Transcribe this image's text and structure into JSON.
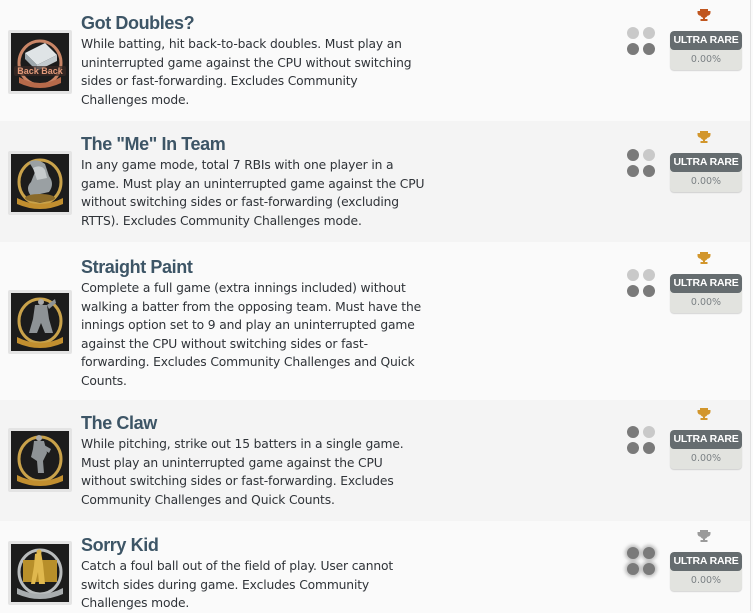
{
  "achievements": [
    {
      "title": "Got Doubles?",
      "description": "While batting, hit back-to-back doubles. Must play an uninterrupted game against the CPU without switching sides or fast-forwarding. Excludes Community Challenges mode.",
      "icon": "back-to-back-base-trophy-icon",
      "icon_text": "Back Back",
      "trophy_tier": "bronze",
      "trophy_color": "#c0561f",
      "difficulty_dots": [
        false,
        false,
        true,
        true
      ],
      "rarity_label": "ULTRA RARE",
      "rarity_percent": "0.00%"
    },
    {
      "title": "The \"Me\" In Team",
      "description": "In any game mode, total 7 RBIs with one player in a game. Must play an uninterrupted game against the CPU without switching sides or fast-forwarding (excluding RTTS). Excludes Community Challenges mode.",
      "icon": "flexed-arm-trophy-icon",
      "trophy_tier": "gold",
      "trophy_color": "#d2962c",
      "difficulty_dots": [
        true,
        false,
        true,
        true
      ],
      "rarity_label": "ULTRA RARE",
      "rarity_percent": "0.00%"
    },
    {
      "title": "Straight Paint",
      "description": "Complete a full game (extra innings included) without walking a batter from the opposing team. Must have the innings option set to 9 and play an uninterrupted game against the CPU without switching sides or fast-forwarding. Excludes Community Challenges and Quick Counts.",
      "icon": "pitcher-trophy-icon",
      "trophy_tier": "gold",
      "trophy_color": "#d2962c",
      "difficulty_dots": [
        false,
        false,
        true,
        true
      ],
      "rarity_label": "ULTRA RARE",
      "rarity_percent": "0.00%"
    },
    {
      "title": "The Claw",
      "description": "While pitching, strike out 15 batters in a single game. Must play an uninterrupted game against the CPU without switching sides or fast-forwarding. Excludes Community Challenges and Quick Counts.",
      "icon": "pitcher-windup-trophy-icon",
      "trophy_tier": "gold",
      "trophy_color": "#d2962c",
      "difficulty_dots": [
        true,
        false,
        true,
        true
      ],
      "rarity_label": "ULTRA RARE",
      "rarity_percent": "0.00%"
    },
    {
      "title": "Sorry Kid",
      "description": "Catch a foul ball out of the field of play. User cannot switch sides during game. Excludes Community Challenges mode.",
      "icon": "foul-ball-catch-trophy-icon",
      "trophy_tier": "silver",
      "trophy_color": "#9a9a9a",
      "difficulty_dots": [
        true,
        true,
        true,
        true
      ],
      "rarity_label": "ULTRA RARE",
      "rarity_percent": "0.00%"
    }
  ]
}
